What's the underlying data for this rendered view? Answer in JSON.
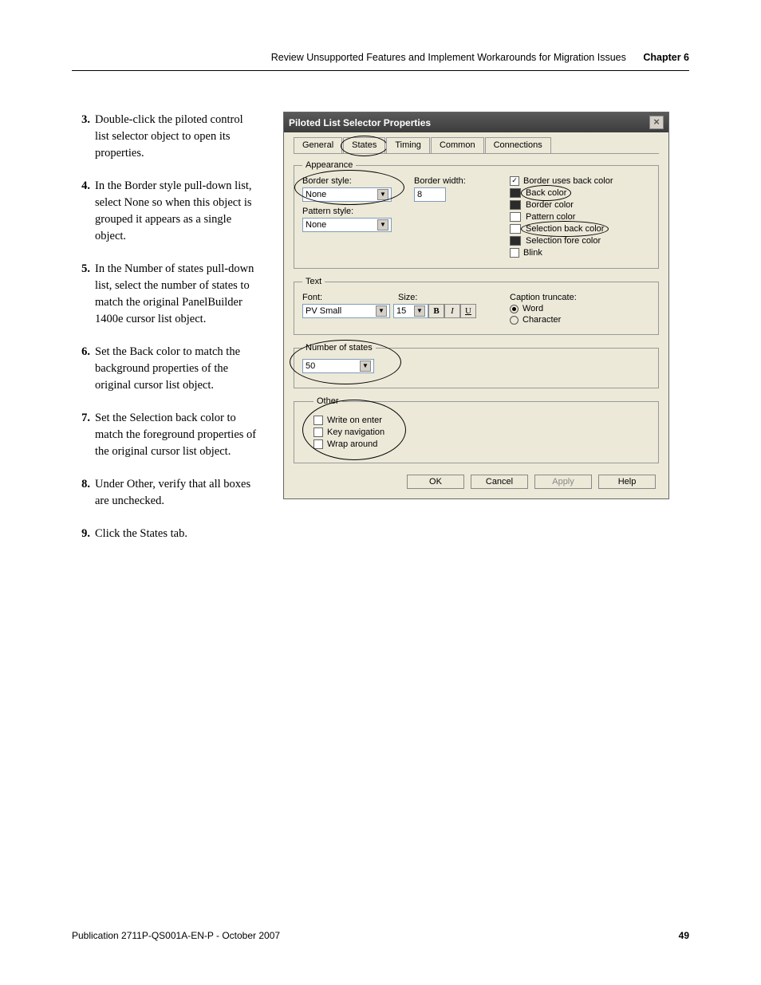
{
  "header": {
    "title": "Review Unsupported Features and Implement Workarounds for Migration Issues",
    "chapter": "Chapter 6"
  },
  "steps": [
    {
      "n": "3.",
      "t": "Double-click the piloted control list selector object to open its properties."
    },
    {
      "n": "4.",
      "t": "In the Border style pull-down list, select None so when this object is grouped it appears as a single object."
    },
    {
      "n": "5.",
      "t": "In the Number of states pull-down list, select the number of states to match the original PanelBuilder 1400e cursor list object."
    },
    {
      "n": "6.",
      "t": "Set the Back color to match the background properties of the original cursor list object."
    },
    {
      "n": "7.",
      "t": "Set the Selection back color to match the foreground properties of the original cursor list object."
    },
    {
      "n": "8.",
      "t": "Under Other, verify that all boxes are unchecked."
    },
    {
      "n": "9.",
      "t": "Click the States tab."
    }
  ],
  "dialog": {
    "title": "Piloted List Selector Properties",
    "tabs": [
      "General",
      "States",
      "Timing",
      "Common",
      "Connections"
    ],
    "appearance": {
      "legend": "Appearance",
      "border_style_label": "Border style:",
      "border_style_value": "None",
      "pattern_style_label": "Pattern style:",
      "pattern_style_value": "None",
      "border_width_label": "Border width:",
      "border_width_value": "8",
      "border_uses_back_label": "Border uses back color",
      "back_color": "Back color",
      "border_color": "Border color",
      "pattern_color": "Pattern color",
      "selection_back": "Selection back color",
      "selection_fore": "Selection fore color",
      "blink": "Blink"
    },
    "text": {
      "legend": "Text",
      "font_label": "Font:",
      "font_value": "PV Small",
      "size_label": "Size:",
      "size_value": "15",
      "caption_label": "Caption truncate:",
      "word": "Word",
      "character": "Character"
    },
    "numstates": {
      "legend": "Number of states",
      "value": "50"
    },
    "other": {
      "legend": "Other",
      "write": "Write on enter",
      "keynav": "Key navigation",
      "wrap": "Wrap around"
    },
    "buttons": {
      "ok": "OK",
      "cancel": "Cancel",
      "apply": "Apply",
      "help": "Help"
    }
  },
  "footer": {
    "pub": "Publication 2711P-QS001A-EN-P - October 2007",
    "page": "49"
  }
}
